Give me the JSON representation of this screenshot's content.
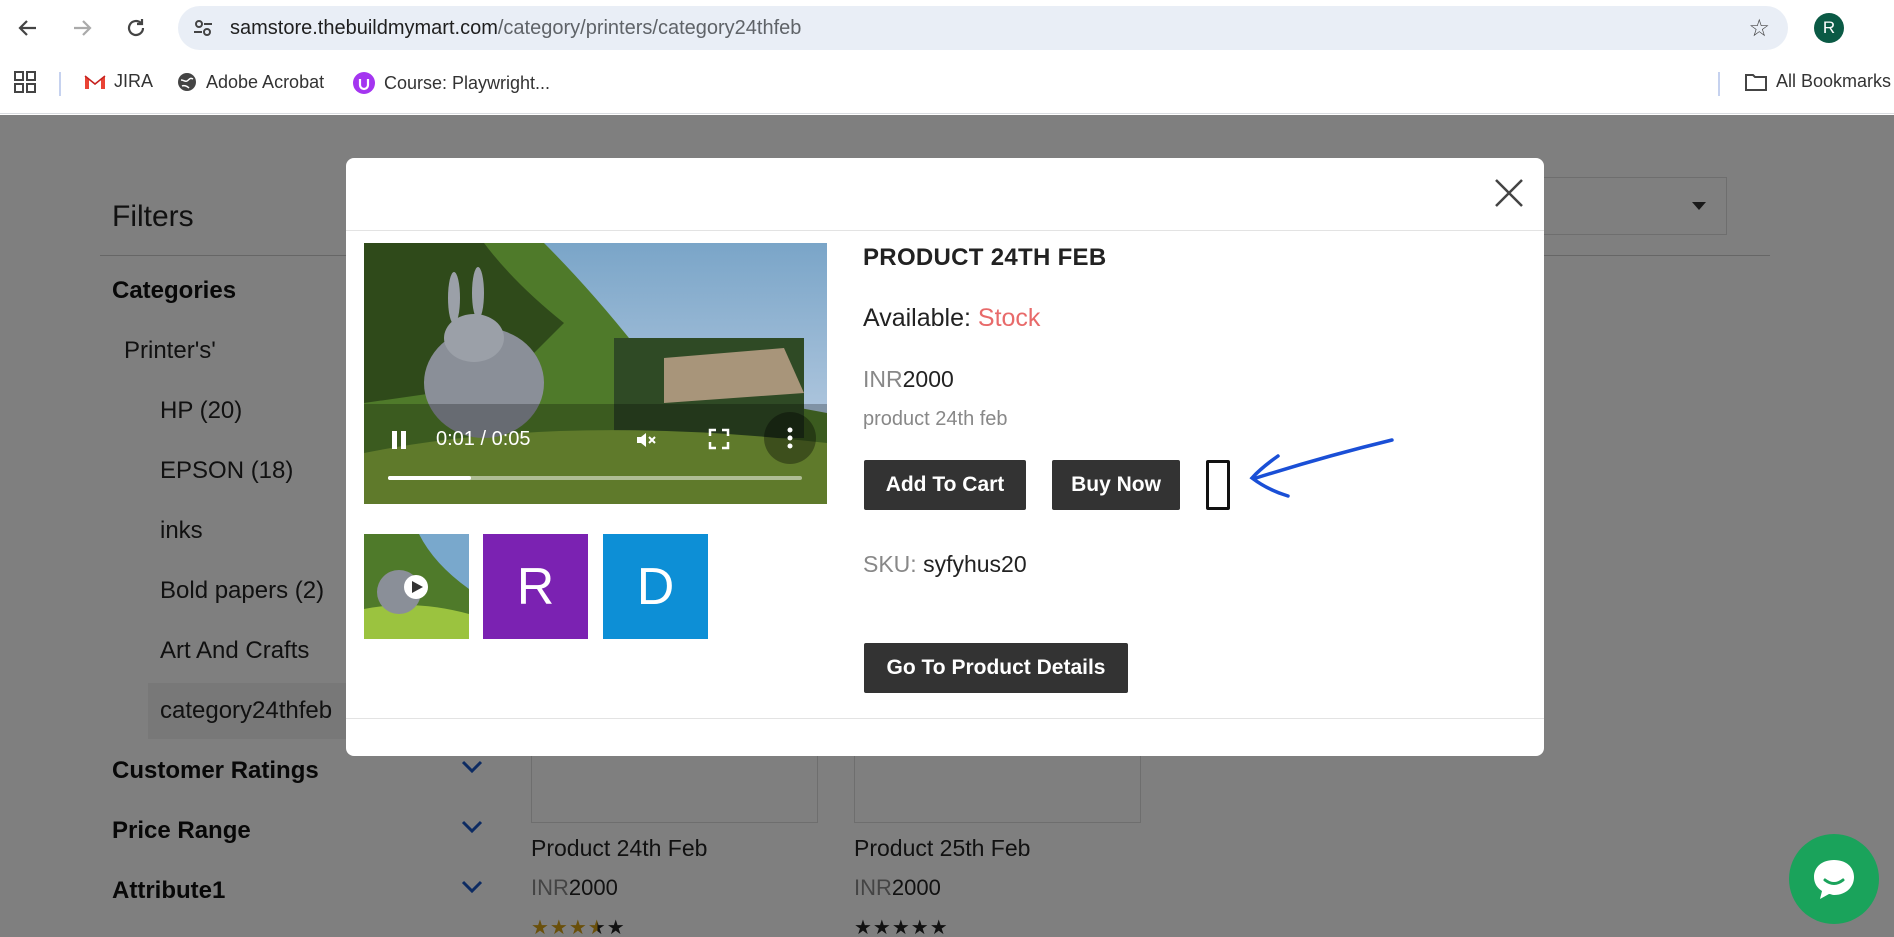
{
  "browser": {
    "url_host": "samstore.thebuildmymart.com",
    "url_path": "/category/printers/category24thfeb",
    "profile_initial": "R",
    "bookmarks": [
      "JIRA",
      "Adobe Acrobat",
      "Course: Playwright..."
    ],
    "all_bookmarks": "All Bookmarks"
  },
  "sidebar": {
    "title": "Filters",
    "categories_heading": "Categories",
    "parent_category": "Printer's'",
    "items": [
      "HP (20)",
      "EPSON (18)",
      "inks",
      "Bold papers (2)",
      "Art And Crafts",
      "category24thfeb"
    ],
    "sections": [
      "Customer Ratings",
      "Price Range",
      "Attribute1"
    ]
  },
  "products": [
    {
      "name": "Product 24th Feb",
      "currency": "INR",
      "price": "2000",
      "rating": 3.5
    },
    {
      "name": "Product 25th Feb",
      "currency": "INR",
      "price": "2000",
      "rating": 0
    }
  ],
  "modal": {
    "title": "PRODUCT 24TH FEB",
    "available_label": "Available:",
    "available_value": "Stock",
    "currency": "INR",
    "price": "2000",
    "description": "product 24th feb",
    "add_to_cart": "Add To Cart",
    "buy_now": "Buy Now",
    "sku_label": "SKU:",
    "sku_value": "syfyhus20",
    "details_button": "Go To Product Details",
    "video": {
      "time": "0:01 / 0:05",
      "progress": 0.2
    },
    "thumbnails": [
      {
        "type": "video",
        "label": ""
      },
      {
        "type": "letter",
        "label": "R",
        "color": "#7b22b2"
      },
      {
        "type": "letter",
        "label": "D",
        "color": "#0d8fd6"
      }
    ]
  },
  "colors": {
    "stock": "#e86a6a",
    "button": "#333333",
    "annotation": "#1a4fd6",
    "chat": "#1aa35b"
  }
}
